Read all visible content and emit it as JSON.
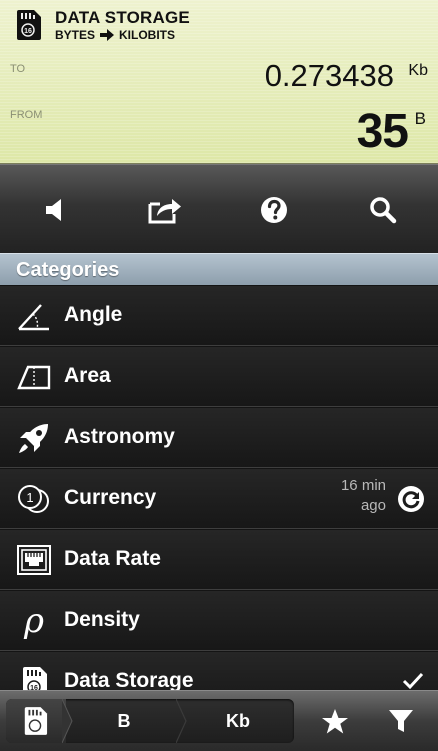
{
  "header": {
    "title": "DATA STORAGE",
    "from_unit_name": "BYTES",
    "to_unit_name": "KILOBITS",
    "to_label": "TO",
    "from_label": "FROM",
    "to_value": "0.273438",
    "to_unit": "Kb",
    "from_value": "35",
    "from_unit": "B"
  },
  "toolbar": {
    "buttons": [
      {
        "icon": "speaker-icon"
      },
      {
        "icon": "share-icon"
      },
      {
        "icon": "help-icon"
      },
      {
        "icon": "search-icon"
      }
    ]
  },
  "categories": {
    "header": "Categories",
    "items": [
      {
        "label": "Angle",
        "icon": "angle-icon"
      },
      {
        "label": "Area",
        "icon": "area-icon"
      },
      {
        "label": "Astronomy",
        "icon": "rocket-icon"
      },
      {
        "label": "Currency",
        "icon": "coins-icon",
        "meta_line1": "16 min",
        "meta_line2": "ago"
      },
      {
        "label": "Data Rate",
        "icon": "ethernet-port-icon"
      },
      {
        "label": "Density",
        "icon": "rho-icon",
        "glyph": "ρ"
      },
      {
        "label": "Data Storage",
        "icon": "sd-card-icon",
        "selected": true
      }
    ]
  },
  "bottom_bar": {
    "crumbs": [
      "B",
      "Kb"
    ],
    "buttons": [
      {
        "icon": "star-icon"
      },
      {
        "icon": "filter-icon"
      }
    ]
  },
  "colors": {
    "display_bg": "#dde7a7",
    "list_bg": "#1c1c1c",
    "category_header": "#9aaab8"
  }
}
